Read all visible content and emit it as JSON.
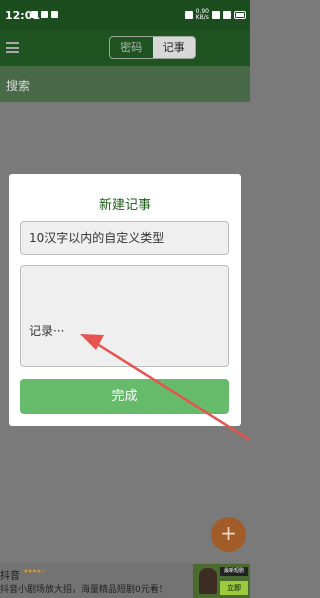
{
  "status_bar": {
    "time": "12:01",
    "net_speed": "0.90\nKB/s"
  },
  "toolbar": {
    "tab_password": "密码",
    "tab_notes": "记事"
  },
  "search": {
    "label": "搜索"
  },
  "dialog": {
    "title": "新建记事",
    "type_field_value": "10汉字以内的自定义类型",
    "note_placeholder": "记录···",
    "done_label": "完成"
  },
  "fab": {
    "label": "+"
  },
  "ad": {
    "app_name": "抖音",
    "rating_stars": "★★★★☆",
    "description": "抖音小剧场放大招，海量精品短剧0元看！",
    "tag": "最新短剧",
    "cta": "立即"
  },
  "colors": {
    "status_bar": "#1c4d1f",
    "toolbar": "#1f5321",
    "search_bar": "#496a48",
    "dialog_title": "#1f5e1c",
    "done_button": "#66bb6a",
    "annotation_arrow": "#e8534f"
  }
}
